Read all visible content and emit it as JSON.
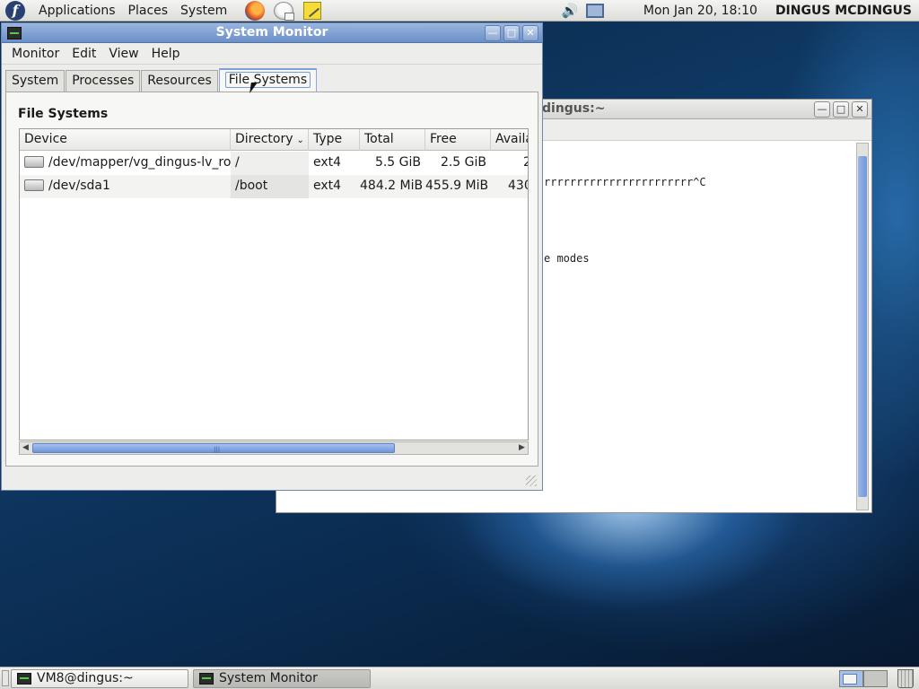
{
  "top_panel": {
    "menus": [
      "Applications",
      "Places",
      "System"
    ],
    "launchers": [
      "firefox-icon",
      "mail-icon",
      "notes-icon"
    ],
    "tray": [
      "volume-icon",
      "network-icon"
    ],
    "clock": "Mon Jan 20, 18:10",
    "user": "DINGUS MCDINGUS"
  },
  "terminal": {
    "title": "dingus:~",
    "lines": [
      "rrrrrrrrrrrrrrrrrrrrrrr^C",
      "",
      "e modes"
    ]
  },
  "sysmon": {
    "title": "System Monitor",
    "menu": [
      "Monitor",
      "Edit",
      "View",
      "Help"
    ],
    "tabs": [
      {
        "label": "System"
      },
      {
        "label": "Processes"
      },
      {
        "label": "Resources"
      },
      {
        "label": "File Systems"
      }
    ],
    "active_tab": "File Systems",
    "section_heading": "File Systems",
    "columns": [
      "Device",
      "Directory",
      "Type",
      "Total",
      "Free",
      "Availa"
    ],
    "sorted_column": "Directory",
    "rows": [
      {
        "device": "/dev/mapper/vg_dingus-lv_root",
        "directory": "/",
        "type": "ext4",
        "total": "5.5 GiB",
        "free": "2.5 GiB",
        "available": "2"
      },
      {
        "device": "/dev/sda1",
        "directory": "/boot",
        "type": "ext4",
        "total": "484.2 MiB",
        "free": "455.9 MiB",
        "available": "430"
      }
    ],
    "h_scroll_fraction": 0.75
  },
  "taskbar": {
    "tasks": [
      {
        "label": "VM8@dingus:~"
      },
      {
        "label": "System Monitor"
      }
    ]
  },
  "colors": {
    "titlebar_active": "#6a8fc8",
    "scroll_thumb": "#6f95d8"
  }
}
